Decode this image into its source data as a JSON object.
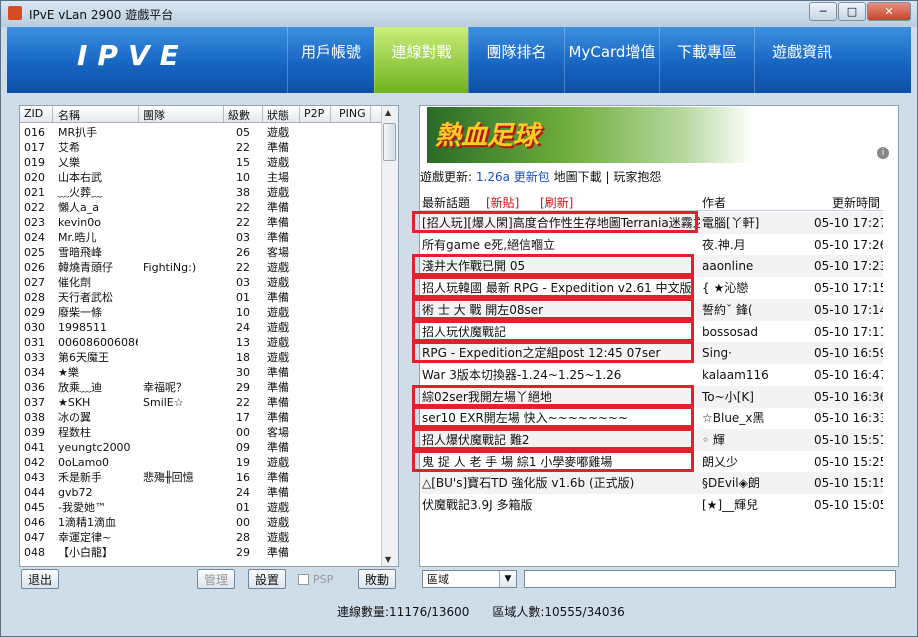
{
  "window": {
    "title": "IPvE vLan 2900 遊戲平台",
    "minimize": "─",
    "maximize": "□",
    "close": "✕"
  },
  "header": {
    "logo": "IPVE",
    "tabs": [
      {
        "label": "用戶帳號",
        "active": false
      },
      {
        "label": "連線對戰",
        "active": true
      },
      {
        "label": "團隊排名",
        "active": false
      },
      {
        "label": "MyCard增值",
        "active": false
      },
      {
        "label": "下載專區",
        "active": false
      },
      {
        "label": "遊戲資訊",
        "active": false
      }
    ]
  },
  "player_list": {
    "columns": [
      "ZID",
      "名稱",
      "團隊",
      "級數",
      "狀態",
      "P2P",
      "PING"
    ],
    "rows": [
      {
        "zid": "016",
        "name": "MR扒手",
        "team": "",
        "level": "05",
        "status": "遊戲"
      },
      {
        "zid": "017",
        "name": "艾希",
        "team": "",
        "level": "22",
        "status": "準備"
      },
      {
        "zid": "019",
        "name": "乂樂",
        "team": "",
        "level": "15",
        "status": "遊戲"
      },
      {
        "zid": "020",
        "name": "山本右武",
        "team": "",
        "level": "10",
        "status": "主場"
      },
      {
        "zid": "021",
        "name": "﹏火葬﹏",
        "team": "",
        "level": "38",
        "status": "遊戲"
      },
      {
        "zid": "022",
        "name": "懶人a_a",
        "team": "",
        "level": "22",
        "status": "準備"
      },
      {
        "zid": "023",
        "name": "kevin0o",
        "team": "",
        "level": "22",
        "status": "準備"
      },
      {
        "zid": "024",
        "name": "Mr.晧儿",
        "team": "",
        "level": "03",
        "status": "準備"
      },
      {
        "zid": "025",
        "name": "雪暗飛峰",
        "team": "",
        "level": "26",
        "status": "客場"
      },
      {
        "zid": "026",
        "name": "韓燒青頭仔",
        "team": "FightiNg:)",
        "level": "22",
        "status": "遊戲"
      },
      {
        "zid": "027",
        "name": "催化劑",
        "team": "",
        "level": "03",
        "status": "遊戲"
      },
      {
        "zid": "028",
        "name": "天行者武松",
        "team": "",
        "level": "01",
        "status": "準備"
      },
      {
        "zid": "029",
        "name": "廢柴一條",
        "team": "",
        "level": "10",
        "status": "遊戲"
      },
      {
        "zid": "030",
        "name": "1998511",
        "team": "",
        "level": "24",
        "status": "遊戲"
      },
      {
        "zid": "031",
        "name": "006086006086",
        "team": "",
        "level": "13",
        "status": "遊戲"
      },
      {
        "zid": "033",
        "name": "第6天魔王",
        "team": "",
        "level": "18",
        "status": "遊戲"
      },
      {
        "zid": "034",
        "name": "★樂",
        "team": "",
        "level": "30",
        "status": "準備"
      },
      {
        "zid": "036",
        "name": "放乘﹏迪",
        "team": "幸福呢？",
        "level": "29",
        "status": "準備"
      },
      {
        "zid": "037",
        "name": "★SKH",
        "team": "SmilE☆",
        "level": "22",
        "status": "準備"
      },
      {
        "zid": "038",
        "name": "冰の翼",
        "team": "",
        "level": "17",
        "status": "準備"
      },
      {
        "zid": "039",
        "name": "程数柱",
        "team": "",
        "level": "00",
        "status": "客場"
      },
      {
        "zid": "041",
        "name": "yeungtc2000",
        "team": "",
        "level": "09",
        "status": "準備"
      },
      {
        "zid": "042",
        "name": "0oLamo0",
        "team": "",
        "level": "19",
        "status": "遊戲"
      },
      {
        "zid": "043",
        "name": "禾是新手",
        "team": "悲殤╫回憶",
        "level": "16",
        "status": "準備"
      },
      {
        "zid": "044",
        "name": "gvb72",
        "team": "",
        "level": "24",
        "status": "準備"
      },
      {
        "zid": "045",
        "name": "-我愛她™",
        "team": "",
        "level": "01",
        "status": "遊戲"
      },
      {
        "zid": "046",
        "name": "1滴精1滴血",
        "team": "",
        "level": "00",
        "status": "遊戲"
      },
      {
        "zid": "047",
        "name": "幸運定律~",
        "team": "",
        "level": "28",
        "status": "遊戲"
      },
      {
        "zid": "048",
        "name": "【小白龍】",
        "team": "",
        "level": "29",
        "status": "準備"
      }
    ]
  },
  "left_buttons": {
    "exit": "退出",
    "manage": "管理",
    "settings": "設置",
    "psp": "PSP",
    "lobby": "敗動"
  },
  "news": {
    "banner_text": "熱血足球",
    "update_label": "遊戲更新:",
    "version": "1.26a",
    "patch": "更新包",
    "map_download": "地圖下載",
    "separator": "|",
    "complaint": "玩家抱怨",
    "header_topic": "最新話題",
    "header_new": "[新貼]",
    "header_refresh": "[刷新]",
    "header_author": "作者",
    "header_time": "更新時間",
    "rows": [
      {
        "title": "[招人玩][爆人閑]高度合作性生存地圖Terrania迷霧之",
        "author": "電腦[丫軒]",
        "time": "05-10 17:27",
        "highlight": true
      },
      {
        "title": "所有game e死,絕信嗰立",
        "author": "夜.神.月",
        "time": "05-10 17:26",
        "highlight": false
      },
      {
        "title": "淺井大作戰已開 05",
        "author": "aaonline",
        "time": "05-10 17:23",
        "highlight": true
      },
      {
        "title": "招人玩韓國 最新 RPG - Expedition v2.61 中文版",
        "author": "{ ★沁戀",
        "time": "05-10 17:15",
        "highlight": true
      },
      {
        "title": "術 士 大 戰 開左08ser",
        "author": "誓約ˇ 鋒(",
        "time": "05-10 17:14",
        "highlight": true
      },
      {
        "title": "招人玩伏魔戰記",
        "author": "bossosad",
        "time": "05-10 17:11",
        "highlight": true
      },
      {
        "title": "RPG - Expedition之定組post 12:45 07ser",
        "author": "Sing·",
        "time": "05-10 16:59",
        "highlight": true
      },
      {
        "title": "War 3版本切換器-1.24~1.25~1.26",
        "author": "kalaam116",
        "time": "05-10 16:47",
        "highlight": false
      },
      {
        "title": "綜02ser我開左場丫絕地",
        "author": "To~小[K]",
        "time": "05-10 16:36",
        "highlight": true
      },
      {
        "title": "ser10 EXR開左場 快入~~~~~~~~",
        "author": "☆Blue_x黑",
        "time": "05-10 16:33",
        "highlight": true
      },
      {
        "title": "招人爆伏魔戰記 難2",
        "author": "◦ 輝",
        "time": "05-10 15:51",
        "highlight": true
      },
      {
        "title": "鬼 捉 人 老 手 場 綜1 小學麥嘟雞場",
        "author": "朗乂少",
        "time": "05-10 15:25",
        "highlight": true
      },
      {
        "title": "△[BU's]寶石TD 強化版 v1.6b (正式版)",
        "author": "§DEvil◈朗",
        "time": "05-10 15:15",
        "highlight": false
      },
      {
        "title": "伏魔戰記3.9J 多箱版",
        "author": "[★]__輝兒",
        "time": "05-10 15:05",
        "highlight": false
      }
    ]
  },
  "chat": {
    "region": "區域",
    "dropdown_arrow": "▼",
    "input_value": ""
  },
  "status": {
    "connections": "連線數量:11176/13600",
    "region_users": "區域人數:10555/34036"
  },
  "colors": {
    "accent": "#1766c2",
    "active_tab": "#8dc63f",
    "highlight_box": "#e0222c"
  }
}
